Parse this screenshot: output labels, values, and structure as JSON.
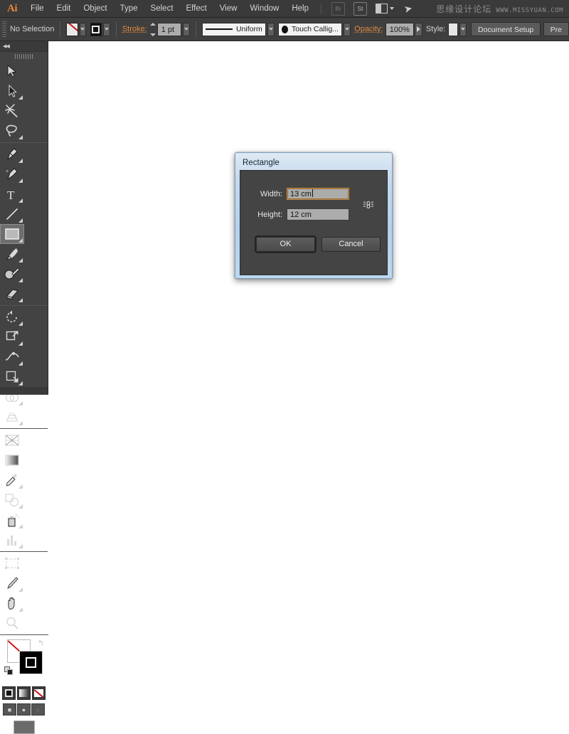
{
  "app": {
    "logo": "Ai",
    "menus": [
      "File",
      "Edit",
      "Object",
      "Type",
      "Select",
      "Effect",
      "View",
      "Window",
      "Help"
    ],
    "bridge_button": "Br",
    "stock_button": "St",
    "watermark_cn": "思缘设计论坛",
    "watermark_en": "WWW.MISSYUAN.COM"
  },
  "control_bar": {
    "selection_status": "No Selection",
    "stroke_label": "Stroke:",
    "stroke_weight": "1 pt",
    "profile_value": "Uniform",
    "brush_value": "Touch Callig...",
    "opacity_label": "Opacity:",
    "opacity_value": "100%",
    "style_label": "Style:",
    "document_setup_button": "Document Setup",
    "preferences_button": "Pre"
  },
  "tools": {
    "collapse_chevron": "◀◀",
    "items": [
      {
        "name": "selection-tool",
        "row": 0,
        "col": 0,
        "selected": false
      },
      {
        "name": "direct-selection-tool",
        "row": 0,
        "col": 1,
        "selected": false
      },
      {
        "name": "magic-wand-tool",
        "row": 1,
        "col": 0,
        "selected": false
      },
      {
        "name": "lasso-tool",
        "row": 1,
        "col": 1,
        "selected": false
      },
      {
        "name": "pen-tool",
        "row": 2,
        "col": 0,
        "selected": false
      },
      {
        "name": "add-anchor-point-tool",
        "row": 2,
        "col": 1,
        "selected": false
      },
      {
        "name": "type-tool",
        "row": 3,
        "col": 0,
        "selected": false
      },
      {
        "name": "line-segment-tool",
        "row": 3,
        "col": 1,
        "selected": false
      },
      {
        "name": "rectangle-tool",
        "row": 4,
        "col": 0,
        "selected": true
      },
      {
        "name": "paintbrush-tool",
        "row": 4,
        "col": 1,
        "selected": false
      },
      {
        "name": "pencil-tool",
        "row": 5,
        "col": 0,
        "selected": false
      },
      {
        "name": "eraser-tool",
        "row": 5,
        "col": 1,
        "selected": false
      },
      {
        "name": "rotate-tool",
        "row": 6,
        "col": 0,
        "selected": false
      },
      {
        "name": "scale-tool",
        "row": 6,
        "col": 1,
        "selected": false
      },
      {
        "name": "width-tool",
        "row": 7,
        "col": 0,
        "selected": false
      },
      {
        "name": "free-transform-tool",
        "row": 7,
        "col": 1,
        "selected": false
      },
      {
        "name": "shape-builder-tool",
        "row": 8,
        "col": 0,
        "selected": false
      },
      {
        "name": "perspective-grid-tool",
        "row": 8,
        "col": 1,
        "selected": false
      },
      {
        "name": "mesh-tool",
        "row": 9,
        "col": 0,
        "selected": false
      },
      {
        "name": "gradient-tool",
        "row": 9,
        "col": 1,
        "selected": false
      },
      {
        "name": "eyedropper-tool",
        "row": 10,
        "col": 0,
        "selected": false
      },
      {
        "name": "blend-tool",
        "row": 10,
        "col": 1,
        "selected": false
      },
      {
        "name": "symbol-sprayer-tool",
        "row": 11,
        "col": 0,
        "selected": false
      },
      {
        "name": "column-graph-tool",
        "row": 11,
        "col": 1,
        "selected": false
      },
      {
        "name": "artboard-tool",
        "row": 12,
        "col": 0,
        "selected": false
      },
      {
        "name": "slice-tool",
        "row": 12,
        "col": 1,
        "selected": false
      },
      {
        "name": "hand-tool",
        "row": 13,
        "col": 0,
        "selected": false
      },
      {
        "name": "zoom-tool",
        "row": 13,
        "col": 1,
        "selected": false
      }
    ],
    "fill_stroke": {
      "fill": "none",
      "stroke": "black",
      "swap_icon": "↰",
      "color_mode": "color",
      "gradient_mode": "gradient",
      "none_mode": "none"
    }
  },
  "dialog": {
    "title": "Rectangle",
    "width_label": "Width:",
    "width_value": "13 cm",
    "height_label": "Height:",
    "height_value": "12 cm",
    "constrain_icon": "constrain-proportions-icon",
    "ok_button": "OK",
    "cancel_button": "Cancel"
  },
  "colors": {
    "menubar_bg": "#3a3a3a",
    "controlbar_bg": "#3f3f3f",
    "toolpanel_bg": "#434343",
    "canvas_bg": "#ffffff",
    "accent_orange": "#e08a3c",
    "dialog_frame": "#b3d2ee",
    "dialog_body": "#444444",
    "focus_border": "#c08b4a"
  }
}
